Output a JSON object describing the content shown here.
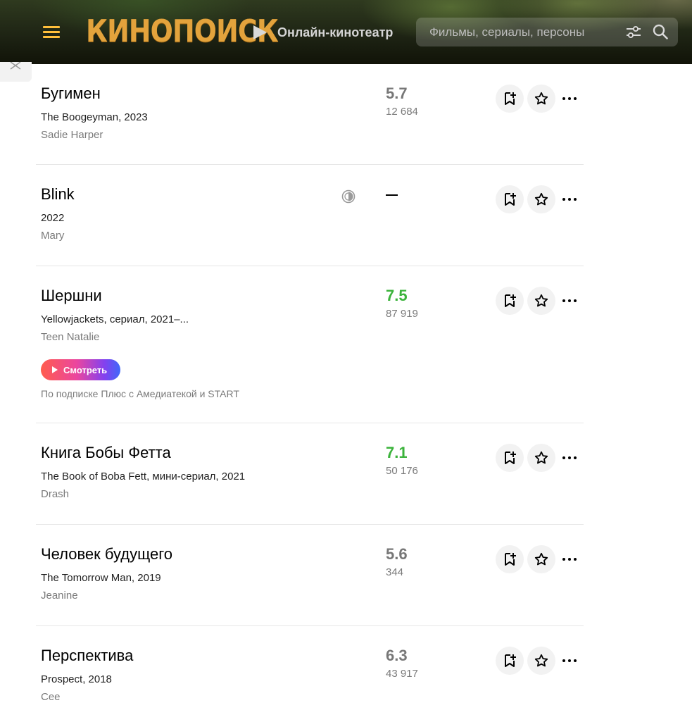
{
  "header": {
    "logo_text": "КИНОПОИСК",
    "online_label": "Онлайн-кинотеатр",
    "search_placeholder": "Фильмы, сериалы, персоны",
    "icons": [
      "menu-icon",
      "play-icon",
      "filter-icon",
      "search-icon"
    ]
  },
  "colors": {
    "logo": "#e3a33c",
    "burger": "#ffbf3b",
    "rating_high": "#3bb33b",
    "rating_neutral": "#777777"
  },
  "items": [
    {
      "title": "Бугимен",
      "original": "The Boogeyman, 2023",
      "role": "Sadie Harper",
      "rating": "5.7",
      "votes": "12 684",
      "rating_color": "neutral"
    },
    {
      "title": "Blink",
      "original": "2022",
      "role": "Mary",
      "rating": "",
      "votes": "",
      "rating_color": "none",
      "status_icon": "half-moon-icon"
    },
    {
      "title": "Шершни",
      "original": "Yellowjackets, сериал, 2021–...",
      "role": "Teen Natalie",
      "rating": "7.5",
      "votes": "87 919",
      "rating_color": "high",
      "watch_label": "Смотреть",
      "subscription_note": "По подписке Плюс с Амедиатекой и START"
    },
    {
      "title": "Книга Бобы Фетта",
      "original": "The Book of Boba Fett, мини-сериал, 2021",
      "role": "Drash",
      "rating": "7.1",
      "votes": "50 176",
      "rating_color": "high"
    },
    {
      "title": "Человек будущего",
      "original": "The Tomorrow Man, 2019",
      "role": "Jeanine",
      "rating": "5.6",
      "votes": "344",
      "rating_color": "neutral"
    },
    {
      "title": "Перспектива",
      "original": "Prospect, 2018",
      "role": "Cee",
      "rating": "6.3",
      "votes": "43 917",
      "rating_color": "neutral"
    }
  ]
}
